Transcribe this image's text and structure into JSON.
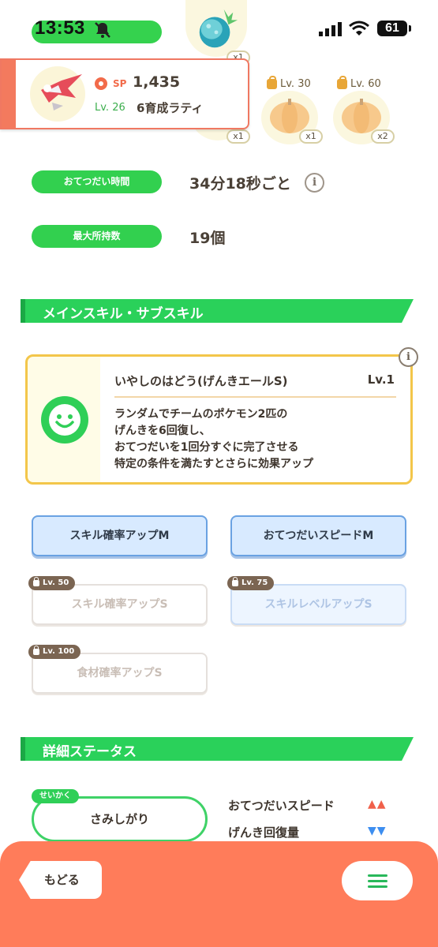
{
  "status_bar": {
    "time": "13:53",
    "battery": "61"
  },
  "ingredients": {
    "main_count": "x1",
    "slots": [
      {
        "count": "x1"
      },
      {
        "lock_level": "Lv. 30",
        "count": "x1"
      },
      {
        "lock_level": "Lv. 60",
        "count": "x2"
      }
    ]
  },
  "pokemon": {
    "sp_label": "SP",
    "sp_value": "1,435",
    "level": "Lv. 26",
    "nickname": "6育成ラティ"
  },
  "info": {
    "help_time_label": "おてつだい時間",
    "help_time_value": "34分18秒ごと",
    "info_icon_glyph": "i",
    "max_carry_label": "最大所持数",
    "max_carry_value": "19個"
  },
  "skills_section": {
    "title": "メインスキル・サブスキル",
    "main_skill": {
      "name": "いやしのはどう(げんきエールS)",
      "level": "Lv.1",
      "desc": [
        "ランダムでチームのポケモン2匹の",
        "げんきを6回復し、",
        "おてつだいを1回分すぐに完了させる",
        "特定の条件を満たすとさらに効果アップ"
      ]
    },
    "sub_skills": [
      {
        "label": "スキル確率アップM"
      },
      {
        "label": "おてつだいスピードM"
      },
      {
        "label": "スキル確率アップS",
        "lock": "Lv. 50"
      },
      {
        "label": "スキルレベルアップS",
        "lock": "Lv. 75"
      },
      {
        "label": "食材確率アップS",
        "lock": "Lv. 100"
      }
    ]
  },
  "detail_section": {
    "title": "詳細ステータス",
    "nature_tag": "せいかく",
    "nature": "さみしがり",
    "effects": [
      {
        "label": "おてつだいスピード",
        "arrows": "▲▲",
        "color": "#f0604a"
      },
      {
        "label": "げんき回復量",
        "arrows": "▼▼",
        "color": "#3d8ef0"
      }
    ]
  },
  "footer": {
    "back_label": "もどる"
  },
  "colors": {
    "green": "#32d04f",
    "coral": "#ff7c5a",
    "blue_border": "#6aa2e2",
    "gold": "#f3c64a"
  }
}
